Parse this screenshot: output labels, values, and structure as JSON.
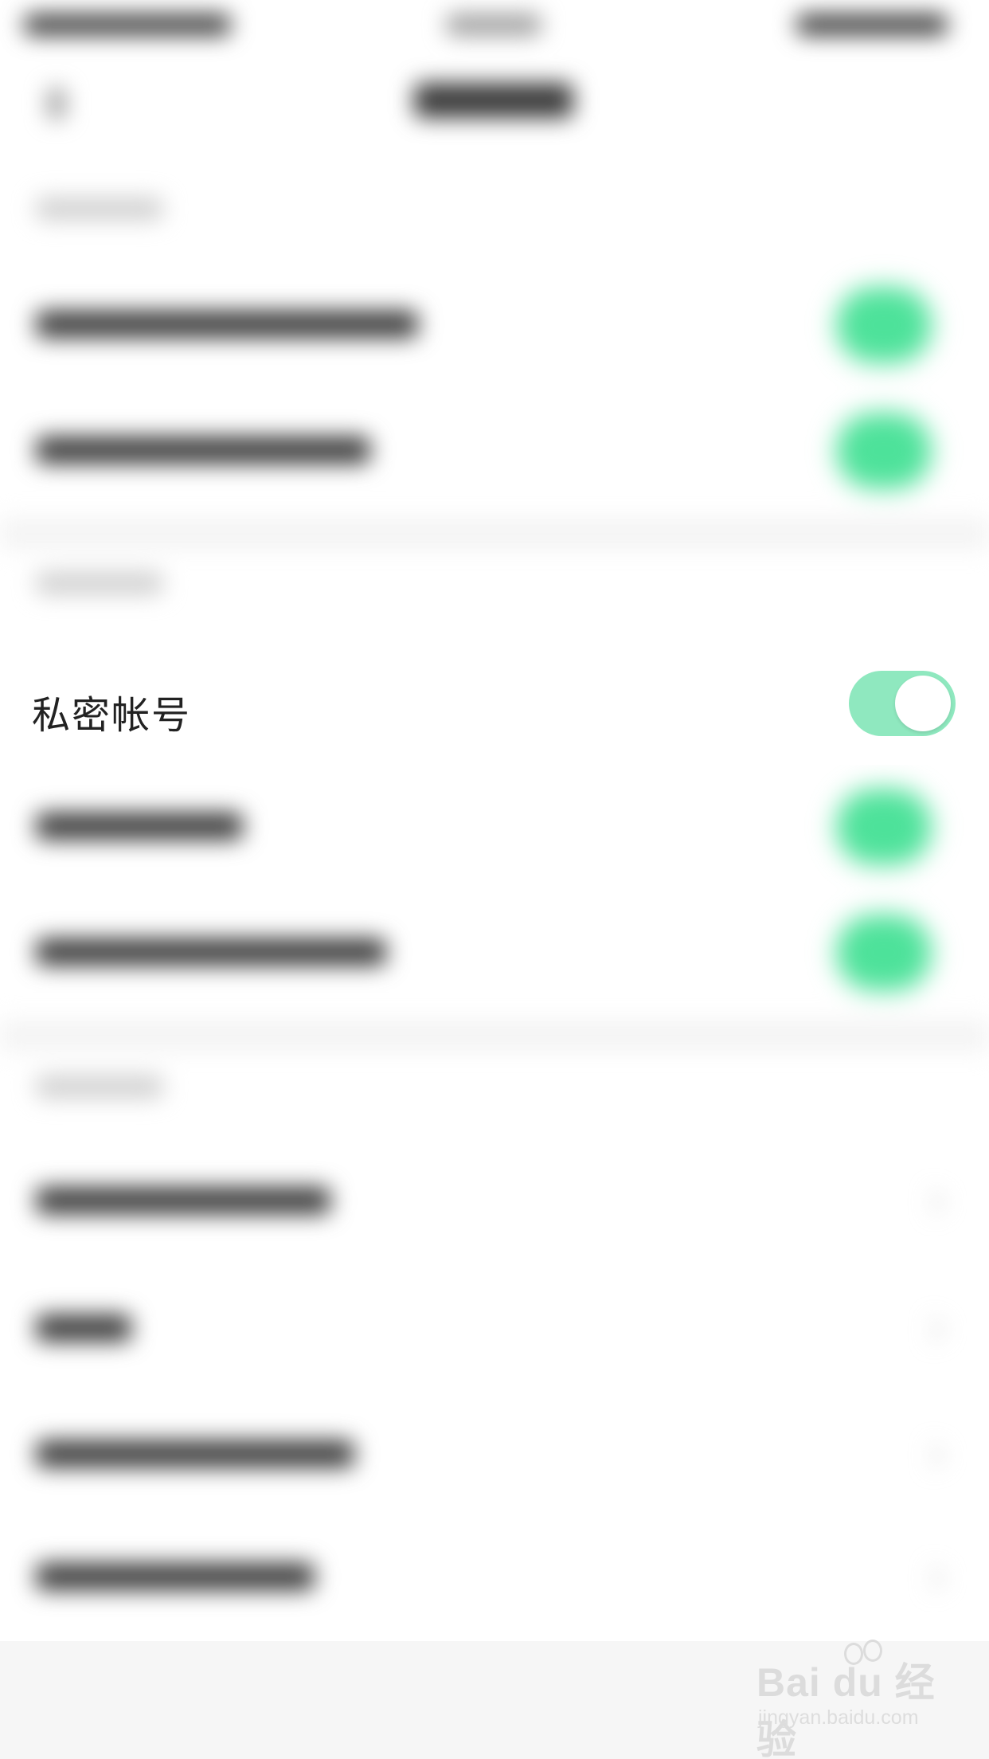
{
  "settings": {
    "private_account": {
      "label": "私密帐号",
      "enabled": true
    }
  },
  "colors": {
    "toggle_on": "#8fe8bf",
    "knob": "#ffffff",
    "text": "#222222",
    "background": "#ffffff"
  },
  "watermark": {
    "logo_text": "Bai du 经验",
    "url": "jingyan.baidu.com"
  },
  "icons": {
    "toggle": "switch-on",
    "logo": "baidu-paw-icon"
  }
}
